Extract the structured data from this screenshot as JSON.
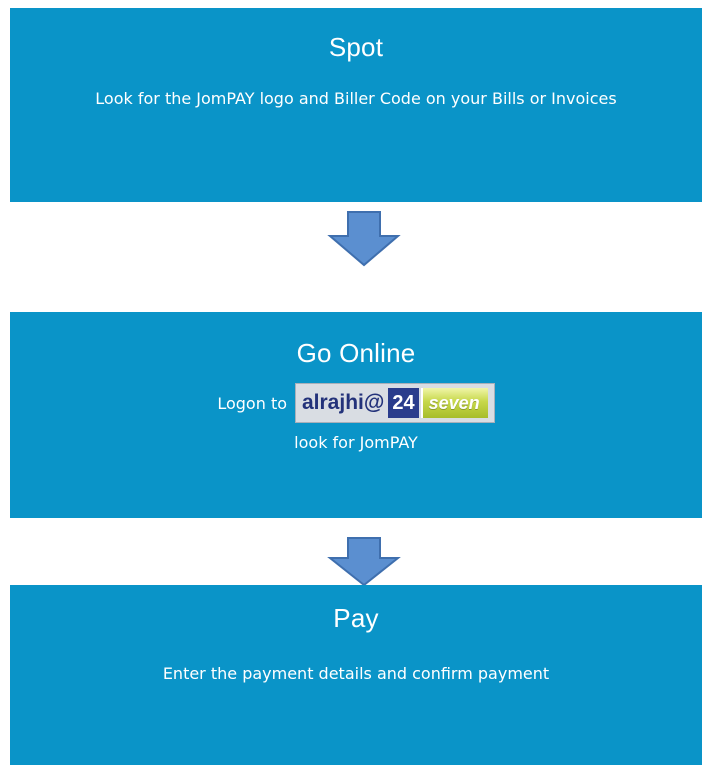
{
  "steps": [
    {
      "title": "Spot",
      "description": "Look for the JomPAY logo and Biller Code on your Bills or Invoices"
    },
    {
      "title": "Go Online",
      "logon_prefix": "Logon to",
      "logo": {
        "word": "alrajhi@",
        "number": "24",
        "tail": "seven"
      },
      "description": "look for JomPAY"
    },
    {
      "title": "Pay",
      "description": "Enter the payment details and confirm payment"
    }
  ],
  "colors": {
    "box": "#0a94c8",
    "arrow": "#5b8fd0",
    "arrow_stroke": "#3f6fae",
    "text": "#ffffff"
  },
  "icons": {
    "arrow": "arrow-down-icon"
  }
}
